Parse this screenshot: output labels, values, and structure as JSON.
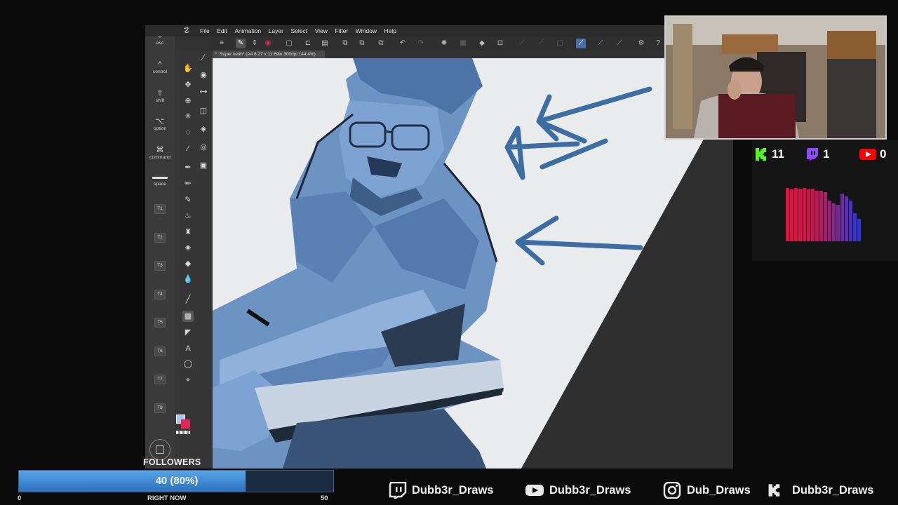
{
  "menu": {
    "items": [
      "File",
      "Edit",
      "Animation",
      "Layer",
      "Select",
      "View",
      "Filter",
      "Window",
      "Help"
    ]
  },
  "document_tab": {
    "title": "Super keith* (A4 8.27 x 11.69in 300dpi 144.4%)"
  },
  "shortcuts": [
    {
      "symbol": "↺",
      "label": "esc"
    },
    {
      "symbol": "^",
      "label": "control"
    },
    {
      "symbol": "⇧",
      "label": "shift"
    },
    {
      "symbol": "⌥",
      "label": "option"
    },
    {
      "symbol": "⌘",
      "label": "command"
    },
    {
      "symbol": "",
      "label": "space"
    }
  ],
  "tool_keys": [
    "T1",
    "T2",
    "T3",
    "T4",
    "T5",
    "T6",
    "T7",
    "T8"
  ],
  "colors": {
    "main": "#a8c4e8",
    "sub": "#e2245a",
    "accent": "#4a6ea8"
  },
  "stats": {
    "kick": "11",
    "twitch": "1",
    "youtube": "0"
  },
  "followers": {
    "title": "FOLLOWERS",
    "progress_text": "40 (80%)",
    "progress": 0.8,
    "min": "0",
    "mid": "RIGHT NOW",
    "max": "50"
  },
  "socials": [
    {
      "platform": "twitch-icon",
      "handle": "Dubb3r_Draws"
    },
    {
      "platform": "youtube-icon",
      "handle": "Dubb3r_Draws"
    },
    {
      "platform": "instagram-icon",
      "handle": "Dub_Draws"
    },
    {
      "platform": "kick-icon",
      "handle": "Dubb3r_Draws"
    }
  ]
}
